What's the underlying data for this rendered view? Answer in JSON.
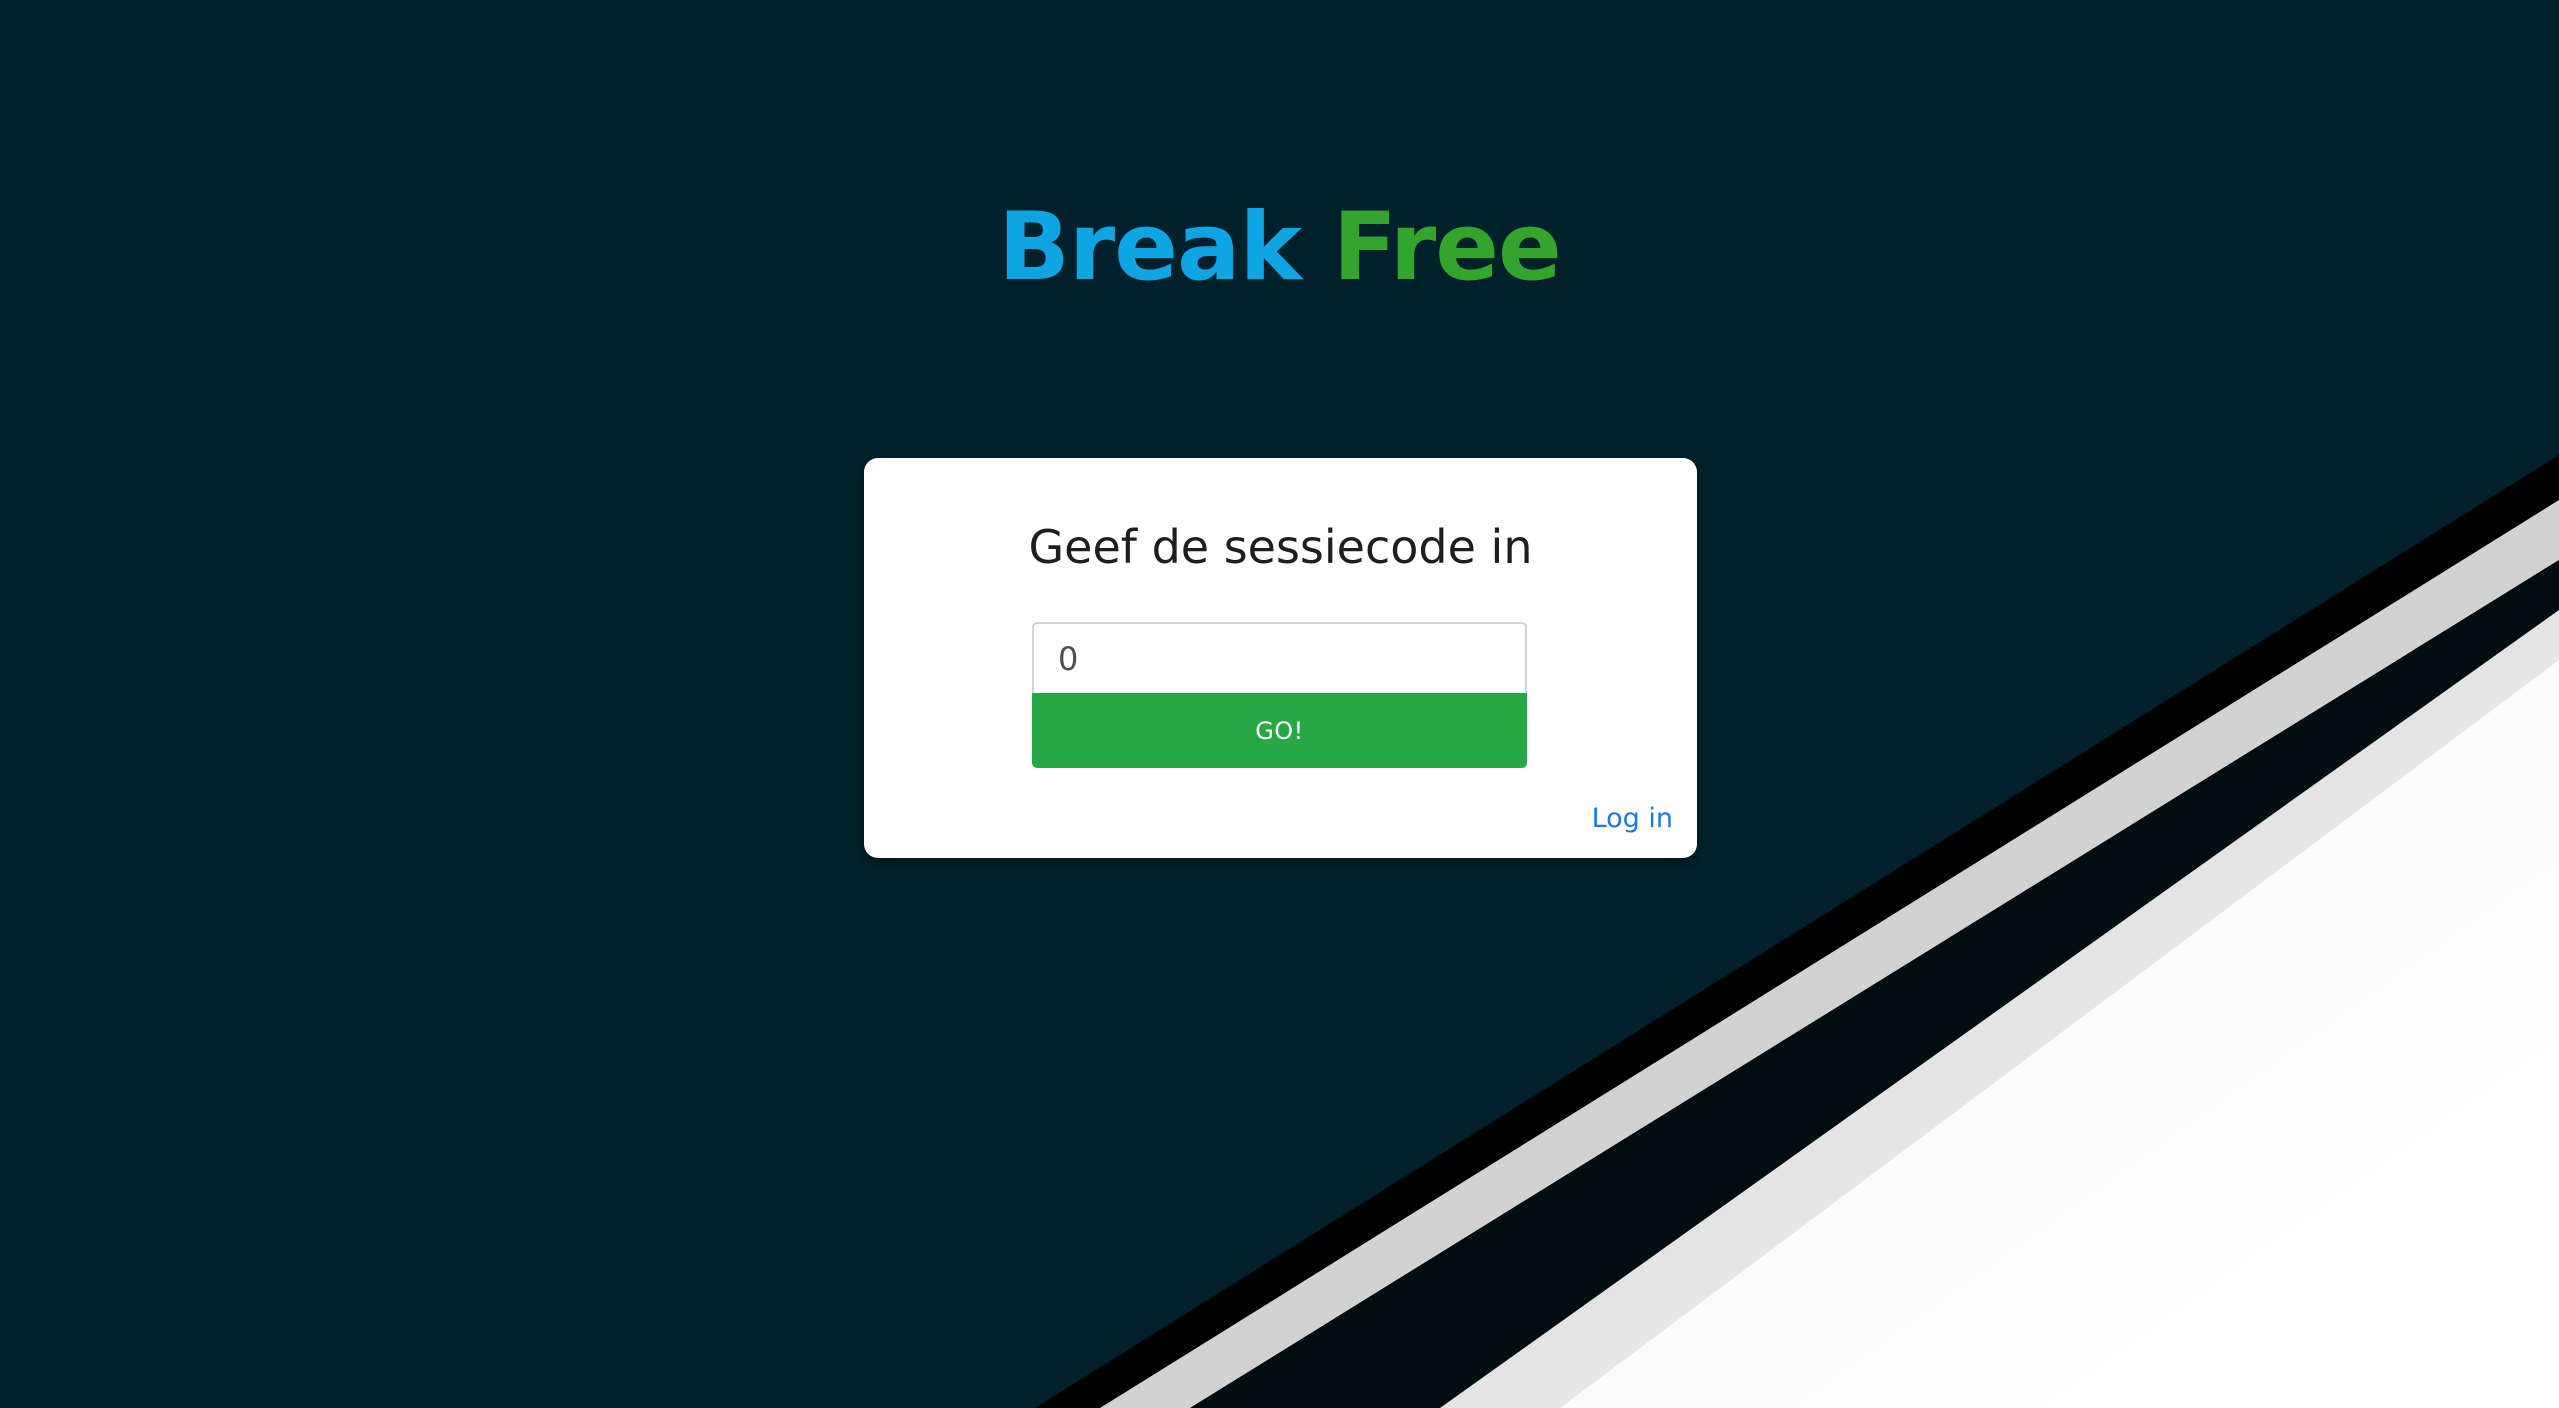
{
  "logo": {
    "word1": "Break",
    "word2": "Free"
  },
  "card": {
    "title": "Geef de sessiecode in",
    "code_value": "0",
    "go_label": "GO!",
    "login_label": "Log in"
  },
  "colors": {
    "background": "#00212b",
    "logo_blue": "#0ea5e3",
    "logo_green": "#33a52d",
    "button_green": "#28a745",
    "link_blue": "#1a7ae8"
  }
}
